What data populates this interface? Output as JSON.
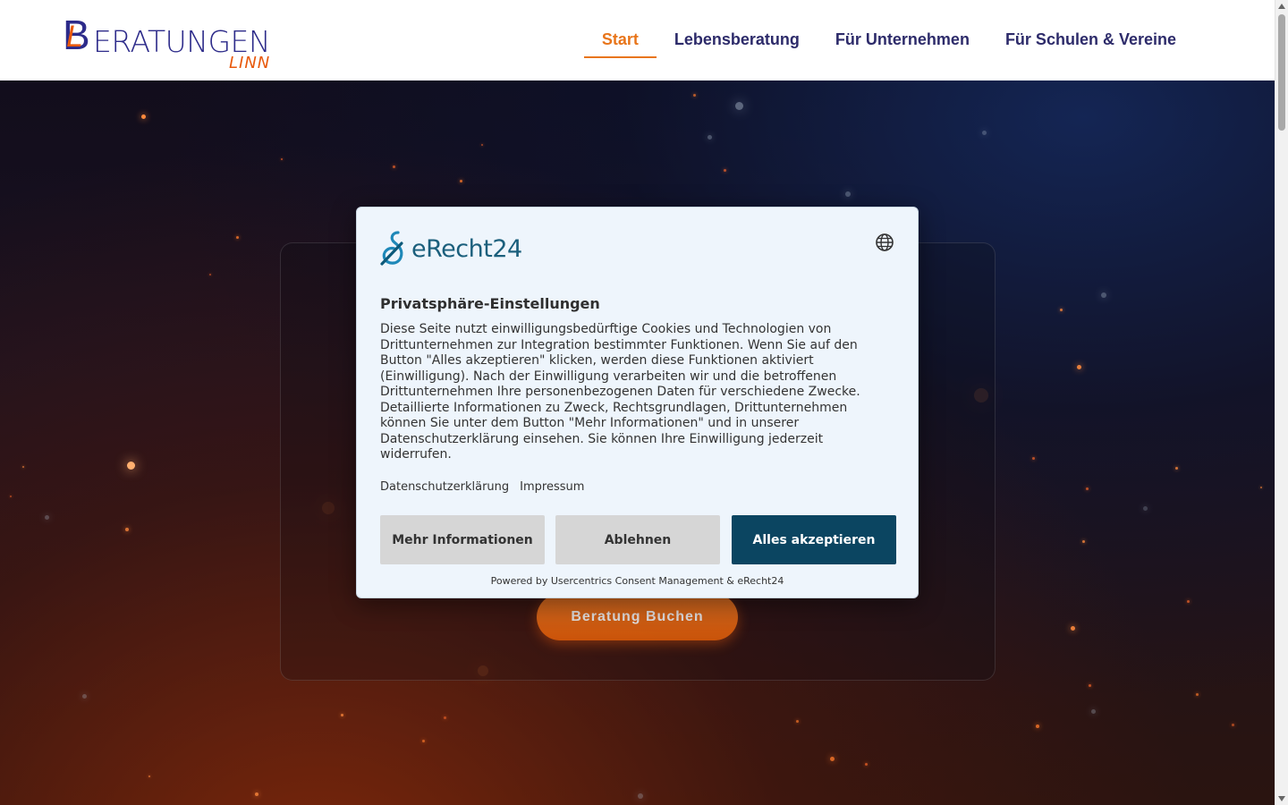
{
  "header": {
    "logo": {
      "letter_b": "B",
      "letter_l": "L",
      "main": "ERATUNGEN",
      "sub": "LINN"
    },
    "nav": [
      {
        "label": "Start",
        "active": true
      },
      {
        "label": "Lebensberatung",
        "active": false
      },
      {
        "label": "Für Unternehmen",
        "active": false
      },
      {
        "label": "Für Schulen & Vereine",
        "active": false
      }
    ]
  },
  "hero": {
    "cta_label": "Beratung Buchen"
  },
  "consent": {
    "brand": "eRecht24",
    "language_icon": "globe-icon",
    "title": "Privatsphäre-Einstellungen",
    "body": "Diese Seite nutzt einwilligungsbedürftige Cookies und Technologien von Drittunternehmen zur Integration bestimmter Funktionen. Wenn Sie auf den Button \"Alles akzeptieren\" klicken, werden diese Funktionen aktiviert (Einwilligung). Nach der Einwilligung verarbeiten wir und die betroffenen Drittunternehmen Ihre personenbezogenen Daten für verschiedene Zwecke. Detaillierte Informationen zu Zweck, Rechtsgrundlagen, Drittunternehmen können Sie unter dem Button \"Mehr Informationen\" und in unserer Datenschutzerklärung einsehen. Sie können Ihre Einwilligung jederzeit widerrufen.",
    "links": {
      "privacy": "Datenschutzerklärung",
      "imprint": "Impressum"
    },
    "buttons": {
      "more": "Mehr Informationen",
      "deny": "Ablehnen",
      "accept": "Alles akzeptieren"
    },
    "powered_by": "Powered by Usercentrics Consent Management & eRecht24"
  },
  "colors": {
    "brand_blue": "#2d2b8a",
    "brand_orange": "#e8751a",
    "accept_button": "#0b4561",
    "consent_bg": "#eef5fc"
  }
}
